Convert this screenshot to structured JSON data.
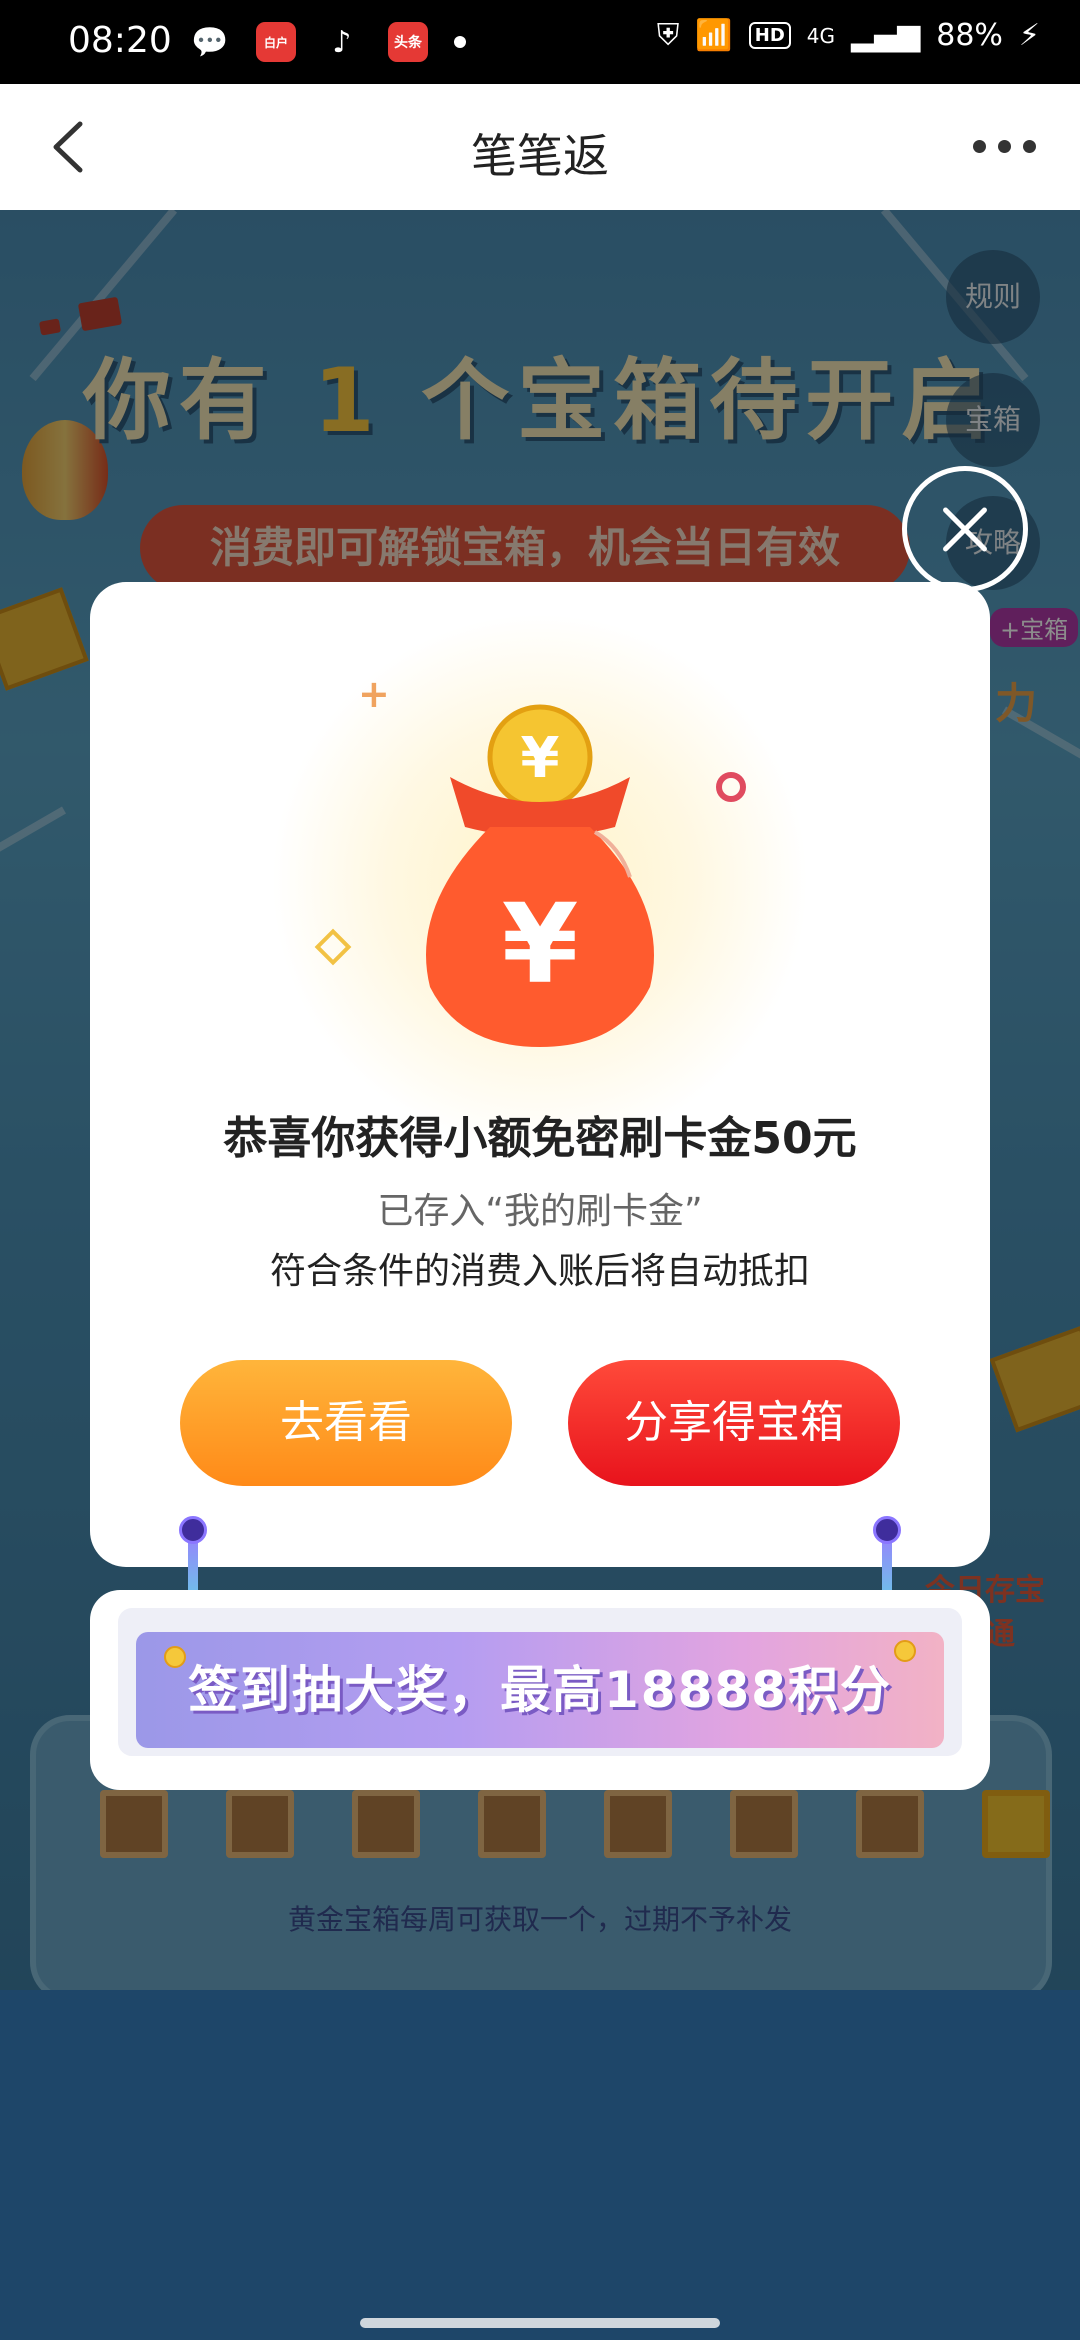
{
  "status_bar": {
    "time": "08:20",
    "app_icons": [
      "wechat-icon",
      "jd-finance-icon",
      "tiktok-icon",
      "toutiao-icon"
    ],
    "app_badge_1": "白户",
    "app_badge_2": "头条",
    "network": "4G",
    "hd": "HD",
    "battery": "88%"
  },
  "nav": {
    "title": "笔笔返"
  },
  "background": {
    "headline_pre": "你有",
    "headline_num": "1",
    "headline_post": "个宝箱待开启",
    "pill_text": "消费即可解锁宝箱，机会当日有效",
    "side_buttons": [
      "规则",
      "宝箱",
      "攻略"
    ],
    "note": "黄金宝箱每周可获取一个，过期不予补发",
    "tag": "+宝箱",
    "tag2": "力",
    "corner_text": "今日存宝直通"
  },
  "modal": {
    "title": "恭喜你获得小额免密刷卡金50元",
    "subtitle1": "已存入“我的刷卡金”",
    "subtitle2": "符合条件的消费入账后将自动抵扣",
    "btn_look": "去看看",
    "btn_share": "分享得宝箱"
  },
  "banner": {
    "text": "签到抽大奖，最高18888积分"
  },
  "colors": {
    "orange": "#ff9a24",
    "red": "#f01d24",
    "bag": "#ff5a2c"
  }
}
